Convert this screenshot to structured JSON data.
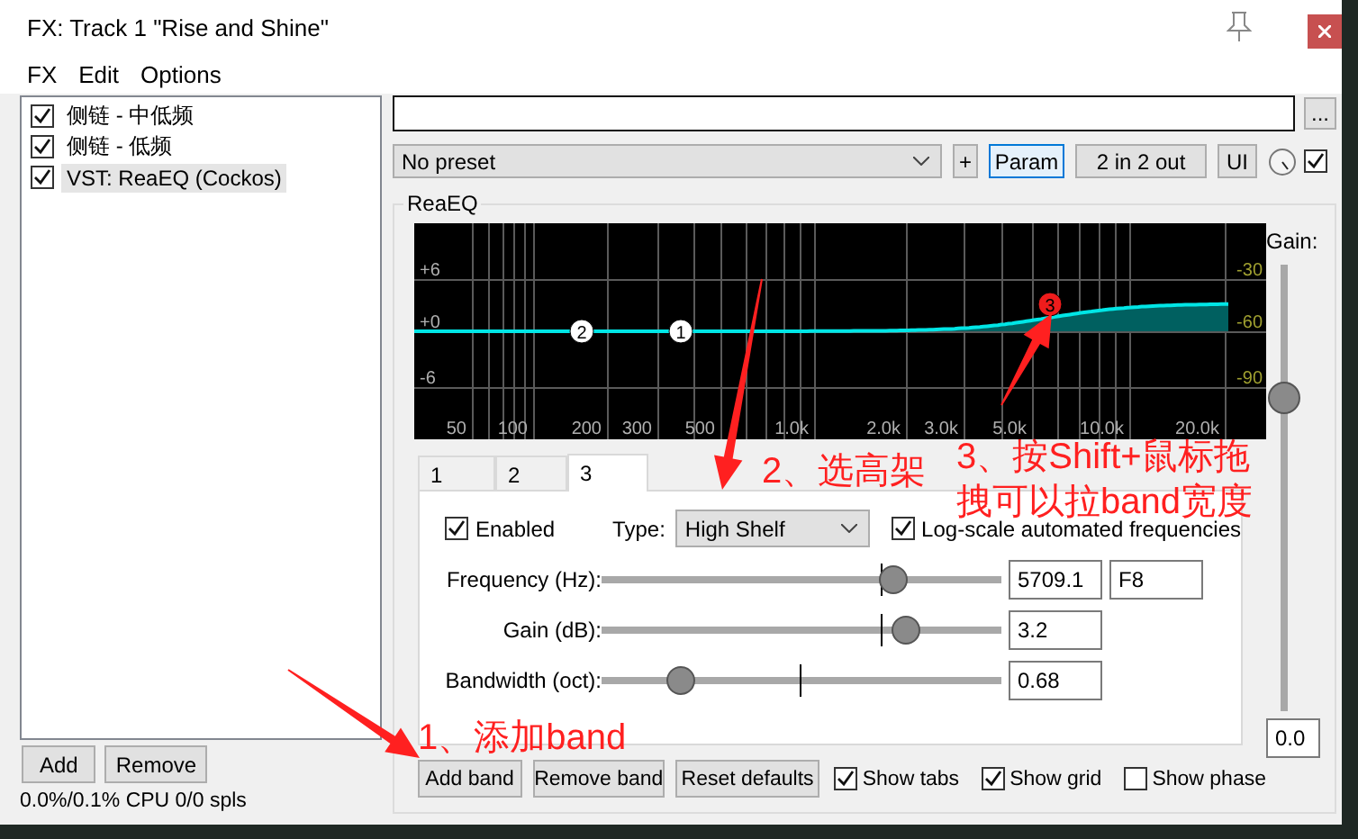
{
  "window": {
    "title": "FX: Track 1 \"Rise and Shine\""
  },
  "menu": [
    {
      "label": "FX"
    },
    {
      "label": "Edit"
    },
    {
      "label": "Options"
    }
  ],
  "fx_chain": [
    {
      "name": "侧链 - 中低频",
      "checked": true,
      "selected": false
    },
    {
      "name": "侧链 - 低频",
      "checked": true,
      "selected": false
    },
    {
      "name": "VST: ReaEQ (Cockos)",
      "checked": true,
      "selected": true
    }
  ],
  "chain_buttons": [
    "Add",
    "Remove"
  ],
  "cpu_status": "0.0%/0.1% CPU 0/0 spls",
  "browse_button": "...",
  "preset": {
    "value": "No preset"
  },
  "plugin_buttons": [
    {
      "label": "+",
      "selected": false
    },
    {
      "label": "Param",
      "selected": true
    },
    {
      "label": "2 in 2 out",
      "selected": false
    },
    {
      "label": "UI",
      "selected": false
    }
  ],
  "bypass": {
    "checked": true
  },
  "plugin": {
    "name": "ReaEQ",
    "graph": {
      "db_labels": [
        "+6",
        "+0",
        "-6"
      ],
      "right_labels": [
        "-30",
        "-60",
        "-90"
      ],
      "freq_labels": [
        "50",
        "100",
        "200",
        "300",
        "500",
        "1.0k",
        "2.0k",
        "3.0k",
        "5.0k",
        "10.0k",
        "20.0k"
      ],
      "bands": [
        {
          "label": "2",
          "selected": false
        },
        {
          "label": "1",
          "selected": false
        },
        {
          "label": "3",
          "selected": true
        }
      ]
    },
    "output_gain": {
      "label": "Gain:",
      "level": 0.7,
      "value": "0.0"
    },
    "tabs": [
      {
        "label": "1",
        "selected": false
      },
      {
        "label": "2",
        "selected": false
      },
      {
        "label": "3",
        "selected": true
      }
    ],
    "band": {
      "enabled": {
        "label": "Enabled",
        "checked": true
      },
      "type_label": "Type:",
      "type": "High Shelf",
      "log_scale": {
        "label": "Log-scale automated frequencies",
        "checked": true
      },
      "params": [
        {
          "label": "Frequency (Hz):",
          "level": 0.73,
          "value": "5709.1",
          "note": "F8"
        },
        {
          "label": "Gain (dB):",
          "level": 0.76,
          "value": "3.2"
        },
        {
          "label": "Bandwidth (oct):",
          "level": 0.2,
          "value": "0.68"
        }
      ]
    },
    "buttons": [
      "Add band",
      "Remove band",
      "Reset defaults"
    ],
    "options": [
      {
        "label": "Show tabs",
        "checked": true
      },
      {
        "label": "Show grid",
        "checked": true
      },
      {
        "label": "Show phase",
        "checked": false
      }
    ]
  },
  "annotations": [
    {
      "text": "1、添加band"
    },
    {
      "text": "2、选高架"
    },
    {
      "text": "3、按Shift+鼠标拖拽可以拉band宽度"
    }
  ]
}
